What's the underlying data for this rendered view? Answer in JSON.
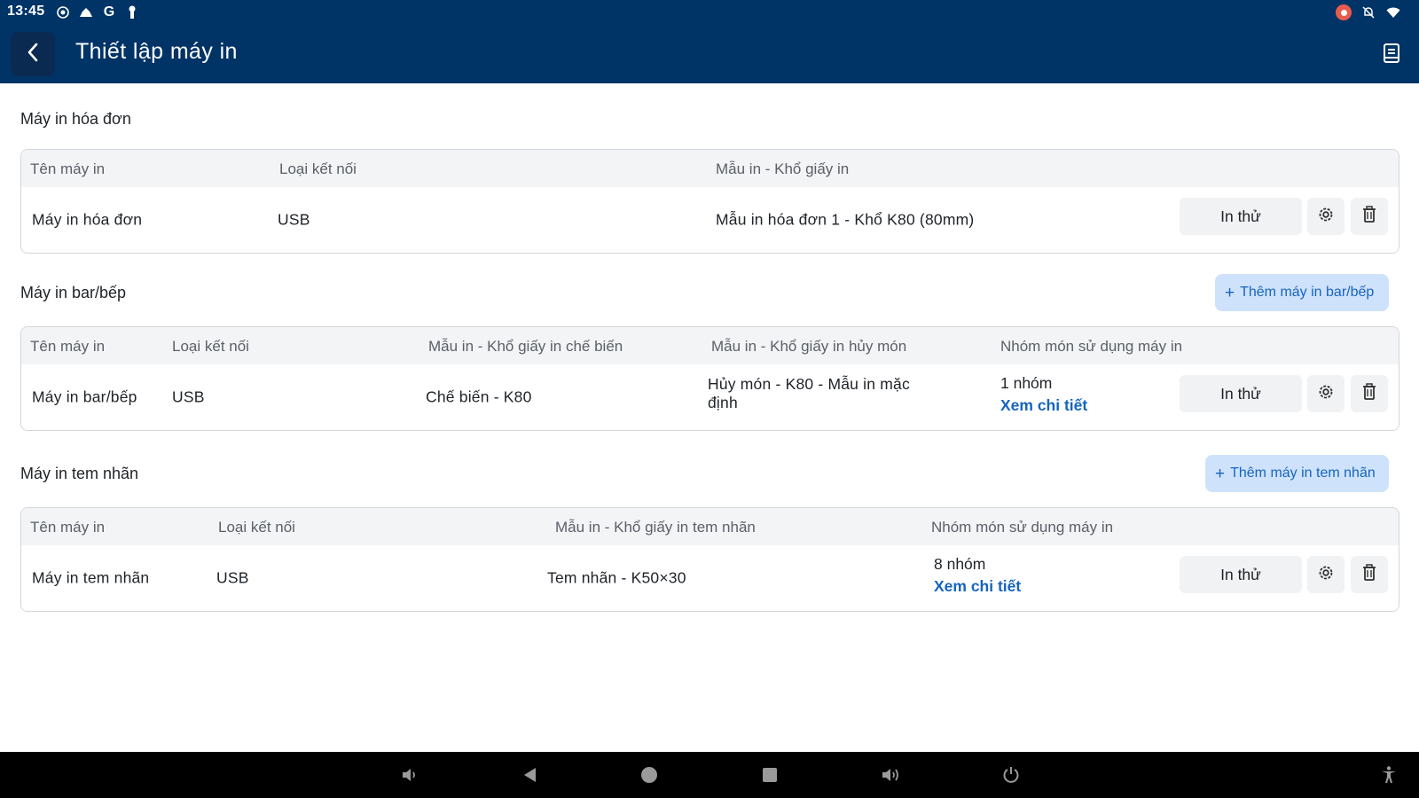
{
  "status_bar": {
    "time": "13:45",
    "left_icons": [
      "screen-record-icon",
      "cloud-icon",
      "google-icon",
      "keyhole-icon"
    ],
    "right_icons": [
      "record-indicator-icon",
      "notifications-off-icon",
      "wifi-icon"
    ]
  },
  "app_bar": {
    "title": "Thiết lập máy in",
    "back_icon": "chevron-left-icon",
    "right_icon": "document-icon"
  },
  "sections": {
    "invoice": {
      "title": "Máy in hóa đơn",
      "columns": [
        "Tên máy in",
        "Loại kết nối",
        "Mẫu in - Khổ giấy in"
      ],
      "row": {
        "name": "Máy in hóa đơn",
        "connection": "USB",
        "template": "Mẫu in hóa đơn 1 - Khổ K80 (80mm)",
        "test_label": "In thử"
      }
    },
    "kitchen": {
      "title": "Máy in bar/bếp",
      "add_label": "Thêm máy in bar/bếp",
      "columns": [
        "Tên máy in",
        "Loại kết nối",
        "Mẫu in - Khổ giấy in chế biến",
        "Mẫu in - Khổ giấy in hủy món",
        "Nhóm món sử dụng máy in"
      ],
      "row": {
        "name": "Máy in bar/bếp",
        "connection": "USB",
        "process_template": "Chế biến - K80",
        "cancel_template": "Hủy món - K80 - Mẫu in mặc định",
        "group_count": "1 nhóm",
        "group_link": "Xem chi tiết",
        "test_label": "In thử"
      }
    },
    "label": {
      "title": "Máy in tem nhãn",
      "add_label": "Thêm máy in tem nhãn",
      "columns": [
        "Tên máy in",
        "Loại kết nối",
        "Mẫu in - Khổ giấy in tem nhãn",
        "Nhóm món sử dụng máy in"
      ],
      "row": {
        "name": "Máy in tem nhãn",
        "connection": "USB",
        "template": "Tem nhãn - K50×30",
        "group_count": "8 nhóm",
        "group_link": "Xem chi tiết",
        "test_label": "In thử"
      }
    }
  },
  "nav_bar": {
    "icons": [
      "volume-down-icon",
      "back-triangle-icon",
      "home-icon",
      "recents-icon",
      "volume-up-icon",
      "power-icon",
      "accessibility-icon"
    ]
  },
  "colors": {
    "app_bar": "#003366",
    "link": "#1565c0",
    "add_button_bg": "#cfe2fb",
    "header_bg": "#f3f4f6"
  }
}
